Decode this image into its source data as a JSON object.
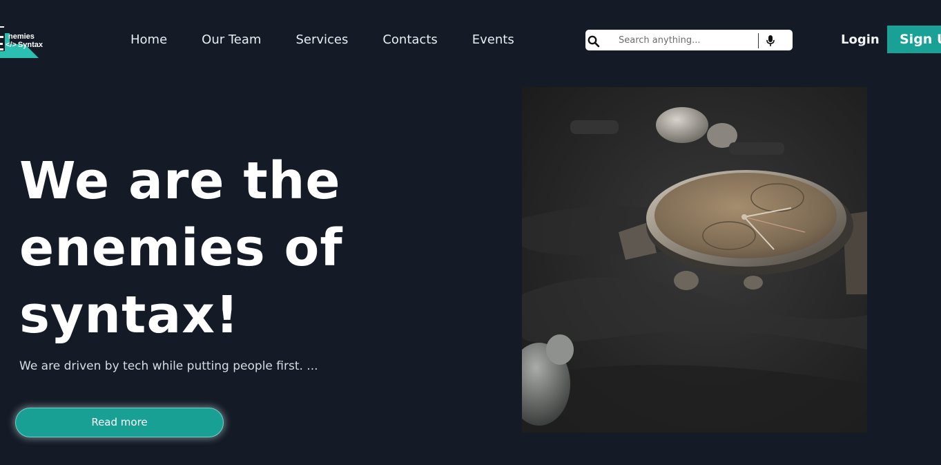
{
  "brand": {
    "line1": "nemies",
    "code_glyph": "</>",
    "line2": "Syntax",
    "accent_color": "#2bbfb1"
  },
  "nav": {
    "items": [
      {
        "label": "Home"
      },
      {
        "label": "Our Team"
      },
      {
        "label": "Services"
      },
      {
        "label": "Contacts"
      },
      {
        "label": "Events"
      }
    ]
  },
  "search": {
    "placeholder": "Search anything...",
    "search_icon": "search-icon",
    "mic_icon": "microphone-icon"
  },
  "auth": {
    "login_label": "Login",
    "signup_label": "Sign Up"
  },
  "hero": {
    "title_line1": "We are the",
    "title_line2": "enemies of",
    "title_line3": "syntax!",
    "subtitle": "We are driven by tech while putting people first. ...",
    "cta_label": "Read more",
    "cta_color": "#17a093"
  },
  "photo": {
    "subject": "wristwatch-photo"
  }
}
